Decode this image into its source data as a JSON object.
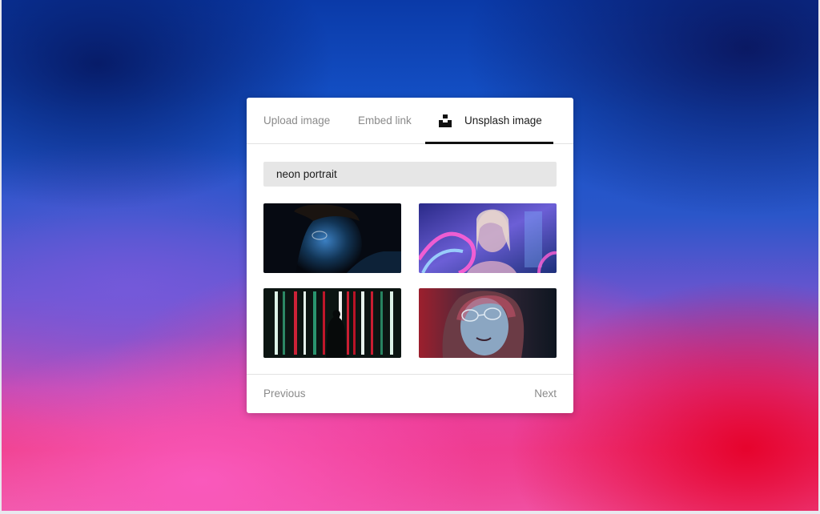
{
  "tabs": [
    {
      "label": "Upload image",
      "active": false
    },
    {
      "label": "Embed link",
      "active": false
    },
    {
      "label": "Unsplash image",
      "active": true,
      "icon": "unsplash-logo-icon"
    }
  ],
  "search": {
    "value": "neon portrait"
  },
  "results": [
    {
      "description": "neon portrait photo, man in blue light"
    },
    {
      "description": "neon portrait photo, woman with glasses and neon tubes"
    },
    {
      "description": "neon portrait photo, silhouette among light bars"
    },
    {
      "description": "neon portrait photo, woman with glasses in red and blue light"
    }
  ],
  "pagination": {
    "previous_label": "Previous",
    "next_label": "Next"
  },
  "colors": {
    "active_tab_underline": "#111111",
    "inactive_text": "#8a8a8a",
    "search_bg": "#e6e6e6"
  }
}
